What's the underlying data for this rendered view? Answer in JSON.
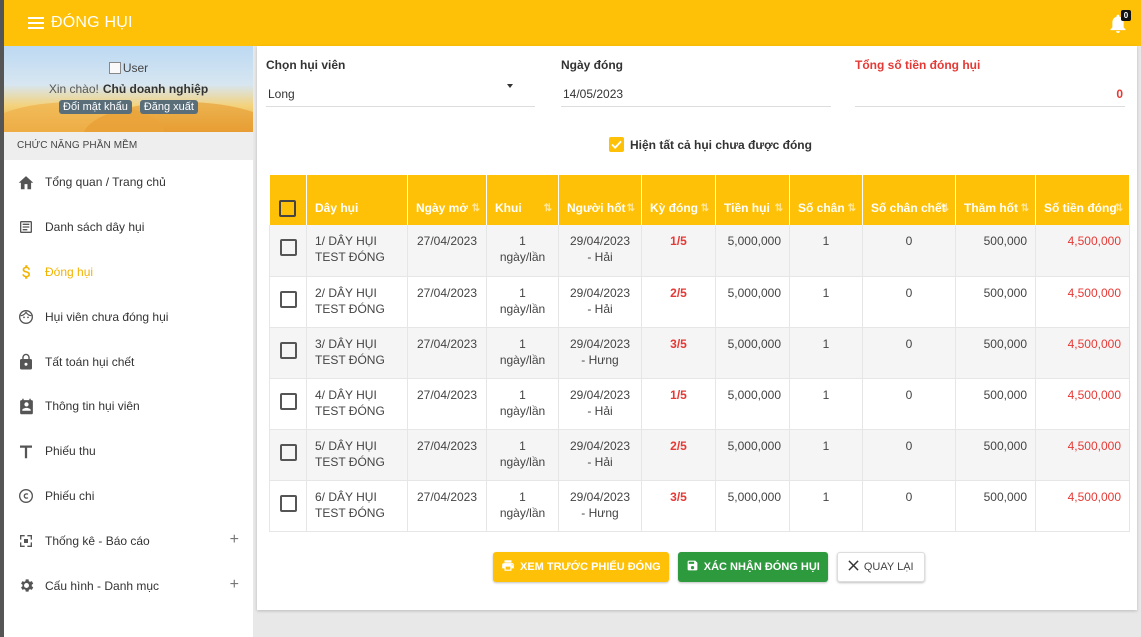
{
  "header": {
    "title": "ĐÓNG HỤI",
    "notification_count": "0"
  },
  "sidebar": {
    "avatar_alt": "User",
    "greeting": "Xin chào!",
    "user_role": "Chủ doanh nghiệp",
    "change_password": "Đổi mật khẩu",
    "logout": "Đăng xuất",
    "section_title": "CHỨC NĂNG PHẦN MỀM",
    "items": [
      {
        "label": "Tổng quan / Trang chủ",
        "icon": "home-icon"
      },
      {
        "label": "Danh sách dây hụi",
        "icon": "list-icon"
      },
      {
        "label": "Đóng hụi",
        "icon": "dollar-icon",
        "active": true
      },
      {
        "label": "Hụi viên chưa đóng hụi",
        "icon": "face-icon"
      },
      {
        "label": "Tất toán hụi chết",
        "icon": "lock-icon"
      },
      {
        "label": "Thông tin hụi viên",
        "icon": "contact-icon"
      },
      {
        "label": "Phiếu thu",
        "icon": "text-icon"
      },
      {
        "label": "Phiếu chi",
        "icon": "copyright-icon"
      },
      {
        "label": "Thống kê - Báo cáo",
        "icon": "report-icon",
        "expandable": true
      },
      {
        "label": "Cấu hình - Danh mục",
        "icon": "gear-icon",
        "expandable": true
      }
    ]
  },
  "form": {
    "member_label": "Chọn hụi viên",
    "member_value": "Long",
    "date_label": "Ngày đóng",
    "date_value": "14/05/2023",
    "total_label": "Tổng số tiền đóng hụi",
    "total_value": "0",
    "show_all_label": "Hiện tất cả hụi chưa được đóng"
  },
  "table": {
    "headers": [
      "Dây hụi",
      "Ngày mở",
      "Khui",
      "Người hốt",
      "Kỳ đóng",
      "Tiền hụi",
      "Số chân",
      "Số chân chết",
      "Thăm hốt",
      "Số tiền đóng"
    ],
    "rows": [
      [
        "1/ DÂY HỤI TEST ĐÓNG",
        "27/04/2023",
        "1 ngày/lần",
        "29/04/2023 - Hải",
        "1/5",
        "5,000,000",
        "1",
        "0",
        "500,000",
        "4,500,000"
      ],
      [
        "2/ DÂY HỤI TEST ĐÓNG",
        "27/04/2023",
        "1 ngày/lần",
        "29/04/2023 - Hải",
        "2/5",
        "5,000,000",
        "1",
        "0",
        "500,000",
        "4,500,000"
      ],
      [
        "3/ DÂY HỤI TEST ĐÓNG",
        "27/04/2023",
        "1 ngày/lần",
        "29/04/2023 - Hưng",
        "3/5",
        "5,000,000",
        "1",
        "0",
        "500,000",
        "4,500,000"
      ],
      [
        "4/ DÂY HỤI TEST ĐÓNG",
        "27/04/2023",
        "1 ngày/lần",
        "29/04/2023 - Hải",
        "1/5",
        "5,000,000",
        "1",
        "0",
        "500,000",
        "4,500,000"
      ],
      [
        "5/ DÂY HỤI TEST ĐÓNG",
        "27/04/2023",
        "1 ngày/lần",
        "29/04/2023 - Hải",
        "2/5",
        "5,000,000",
        "1",
        "0",
        "500,000",
        "4,500,000"
      ],
      [
        "6/ DÂY HỤI TEST ĐÓNG",
        "27/04/2023",
        "1 ngày/lần",
        "29/04/2023 - Hưng",
        "3/5",
        "5,000,000",
        "1",
        "0",
        "500,000",
        "4,500,000"
      ]
    ]
  },
  "actions": {
    "preview": "XEM TRƯỚC PHIẾU ĐÓNG",
    "confirm": "XÁC NHẬN ĐÓNG HỤI",
    "back": "QUAY LẠI"
  },
  "colors": {
    "accent": "#ffc107",
    "success": "#2e9a3e",
    "danger": "#e53935"
  }
}
